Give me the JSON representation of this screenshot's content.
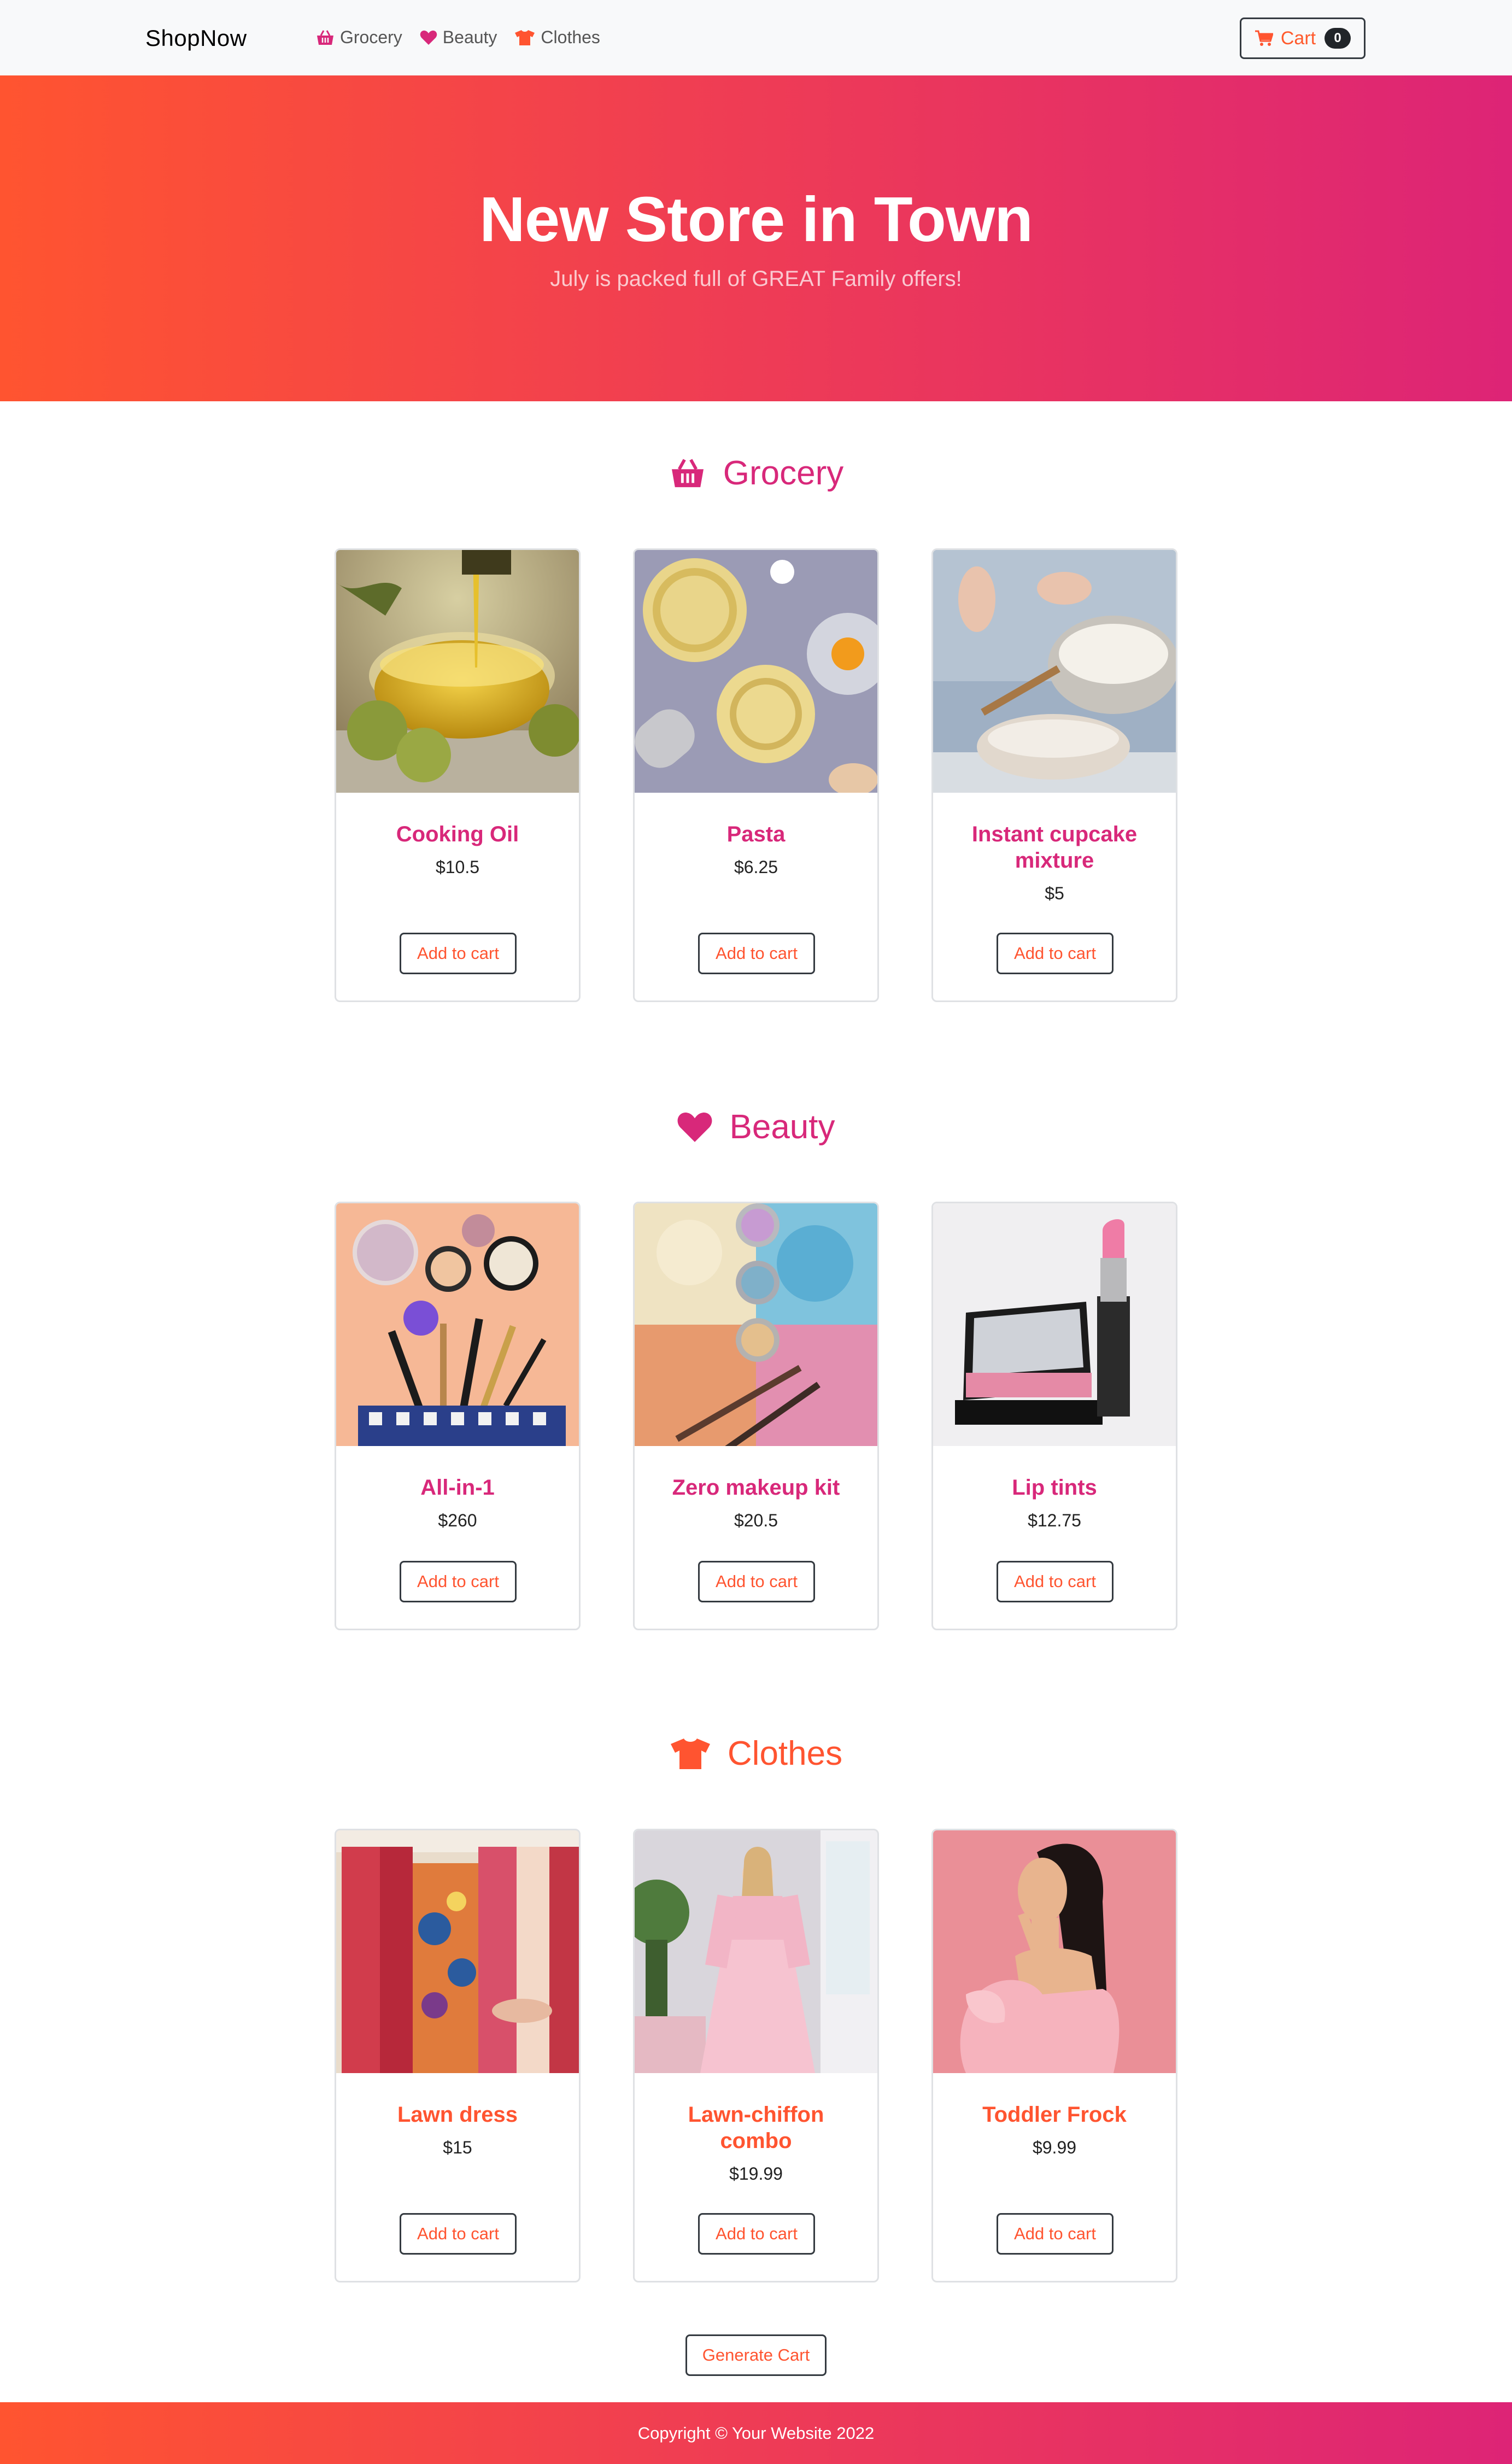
{
  "navbar": {
    "brand": "ShopNow",
    "links": [
      {
        "label": "Grocery",
        "icon": "basket-icon"
      },
      {
        "label": "Beauty",
        "icon": "heart-icon"
      },
      {
        "label": "Clothes",
        "icon": "shirt-icon"
      }
    ],
    "cart_label": "Cart",
    "cart_count": "0"
  },
  "hero": {
    "title": "New Store in Town",
    "subtitle": "July is packed full of GREAT Family offers!"
  },
  "sections": {
    "grocery": {
      "title": "Grocery",
      "icon": "basket-icon",
      "color": "#d8287a",
      "products": [
        {
          "name": "Cooking Oil",
          "price": "$10.5",
          "image": "olive-oil-bowl"
        },
        {
          "name": "Pasta",
          "price": "$6.25",
          "image": "pasta-nests"
        },
        {
          "name": "Instant cupcake mixture",
          "price": "$5",
          "image": "flour-bowl"
        }
      ]
    },
    "beauty": {
      "title": "Beauty",
      "icon": "heart-icon",
      "color": "#d8287a",
      "products": [
        {
          "name": "All-in-1",
          "price": "$260",
          "image": "makeup-bag"
        },
        {
          "name": "Zero makeup kit",
          "price": "$20.5",
          "image": "eyeshadow-powders"
        },
        {
          "name": "Lip tints",
          "price": "$12.75",
          "image": "lipstick-compact"
        }
      ]
    },
    "clothes": {
      "title": "Clothes",
      "icon": "shirt-icon",
      "color": "#ff5430",
      "products": [
        {
          "name": "Lawn dress",
          "price": "$15",
          "image": "clothes-rack"
        },
        {
          "name": "Lawn-chiffon combo",
          "price": "$19.99",
          "image": "pink-gown"
        },
        {
          "name": "Toddler Frock",
          "price": "$9.99",
          "image": "pink-dress-model"
        }
      ]
    }
  },
  "add_to_cart_label": "Add to cart",
  "generate_cart_label": "Generate Cart",
  "footer": {
    "copyright": "Copyright © Your Website 2022"
  },
  "colors": {
    "accent_pink": "#d8287a",
    "accent_orange": "#ff5430",
    "gradient_start": "#ff5430",
    "gradient_end": "#dd2476"
  }
}
